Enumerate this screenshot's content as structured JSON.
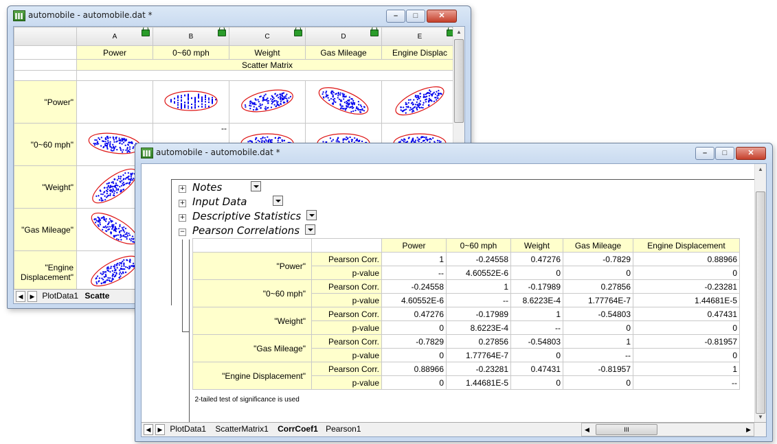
{
  "back_window": {
    "title": "automobile - automobile.dat *",
    "columns": [
      "A",
      "B",
      "C",
      "D",
      "E"
    ],
    "long_names": [
      "Power",
      "0~60 mph",
      "Weight",
      "Gas Mileage",
      "Engine Displac"
    ],
    "matrix_label": "Scatter Matrix",
    "row_labels": [
      "\"Power\"",
      "\"0~60 mph\"",
      "\"Weight\"",
      "\"Gas Mileage\"",
      "\"Engine Displacement\""
    ],
    "dash": "--",
    "tabs": [
      "PlotData1",
      "Scatte"
    ]
  },
  "front_window": {
    "title": "automobile - automobile.dat *",
    "tree": [
      {
        "label": "Notes",
        "toggle": "+"
      },
      {
        "label": "Input Data",
        "toggle": "+"
      },
      {
        "label": "Descriptive Statistics",
        "toggle": "+"
      },
      {
        "label": "Pearson Correlations",
        "toggle": "−"
      }
    ],
    "table": {
      "headers": [
        "Power",
        "0~60 mph",
        "Weight",
        "Gas Mileage",
        "Engine Displacement"
      ],
      "stat_labels": [
        "Pearson Corr.",
        "p-value"
      ],
      "rows": [
        {
          "name": "\"Power\"",
          "corr": [
            "1",
            "-0.24558",
            "0.47276",
            "-0.7829",
            "0.88966"
          ],
          "p": [
            "--",
            "4.60552E-6",
            "0",
            "0",
            "0"
          ]
        },
        {
          "name": "\"0~60 mph\"",
          "corr": [
            "-0.24558",
            "1",
            "-0.17989",
            "0.27856",
            "-0.23281"
          ],
          "p": [
            "4.60552E-6",
            "--",
            "8.6223E-4",
            "1.77764E-7",
            "1.44681E-5"
          ]
        },
        {
          "name": "\"Weight\"",
          "corr": [
            "0.47276",
            "-0.17989",
            "1",
            "-0.54803",
            "0.47431"
          ],
          "p": [
            "0",
            "8.6223E-4",
            "--",
            "0",
            "0"
          ]
        },
        {
          "name": "\"Gas Mileage\"",
          "corr": [
            "-0.7829",
            "0.27856",
            "-0.54803",
            "1",
            "-0.81957"
          ],
          "p": [
            "0",
            "1.77764E-7",
            "0",
            "--",
            "0"
          ]
        },
        {
          "name": "\"Engine Displacement\"",
          "corr": [
            "0.88966",
            "-0.23281",
            "0.47431",
            "-0.81957",
            "1"
          ],
          "p": [
            "0",
            "1.44681E-5",
            "0",
            "0",
            "--"
          ]
        }
      ]
    },
    "footnote": "2-tailed test of significance is used",
    "tabs": [
      "PlotData1",
      "ScatterMatrix1",
      "CorrCoef1",
      "Pearson1"
    ],
    "active_tab": "CorrCoef1",
    "scroll_grip": "III"
  },
  "colors": {
    "accent_yellow": "#ffffcc",
    "scatter_blue": "#0000ee",
    "ellipse_red": "#dd1111"
  }
}
